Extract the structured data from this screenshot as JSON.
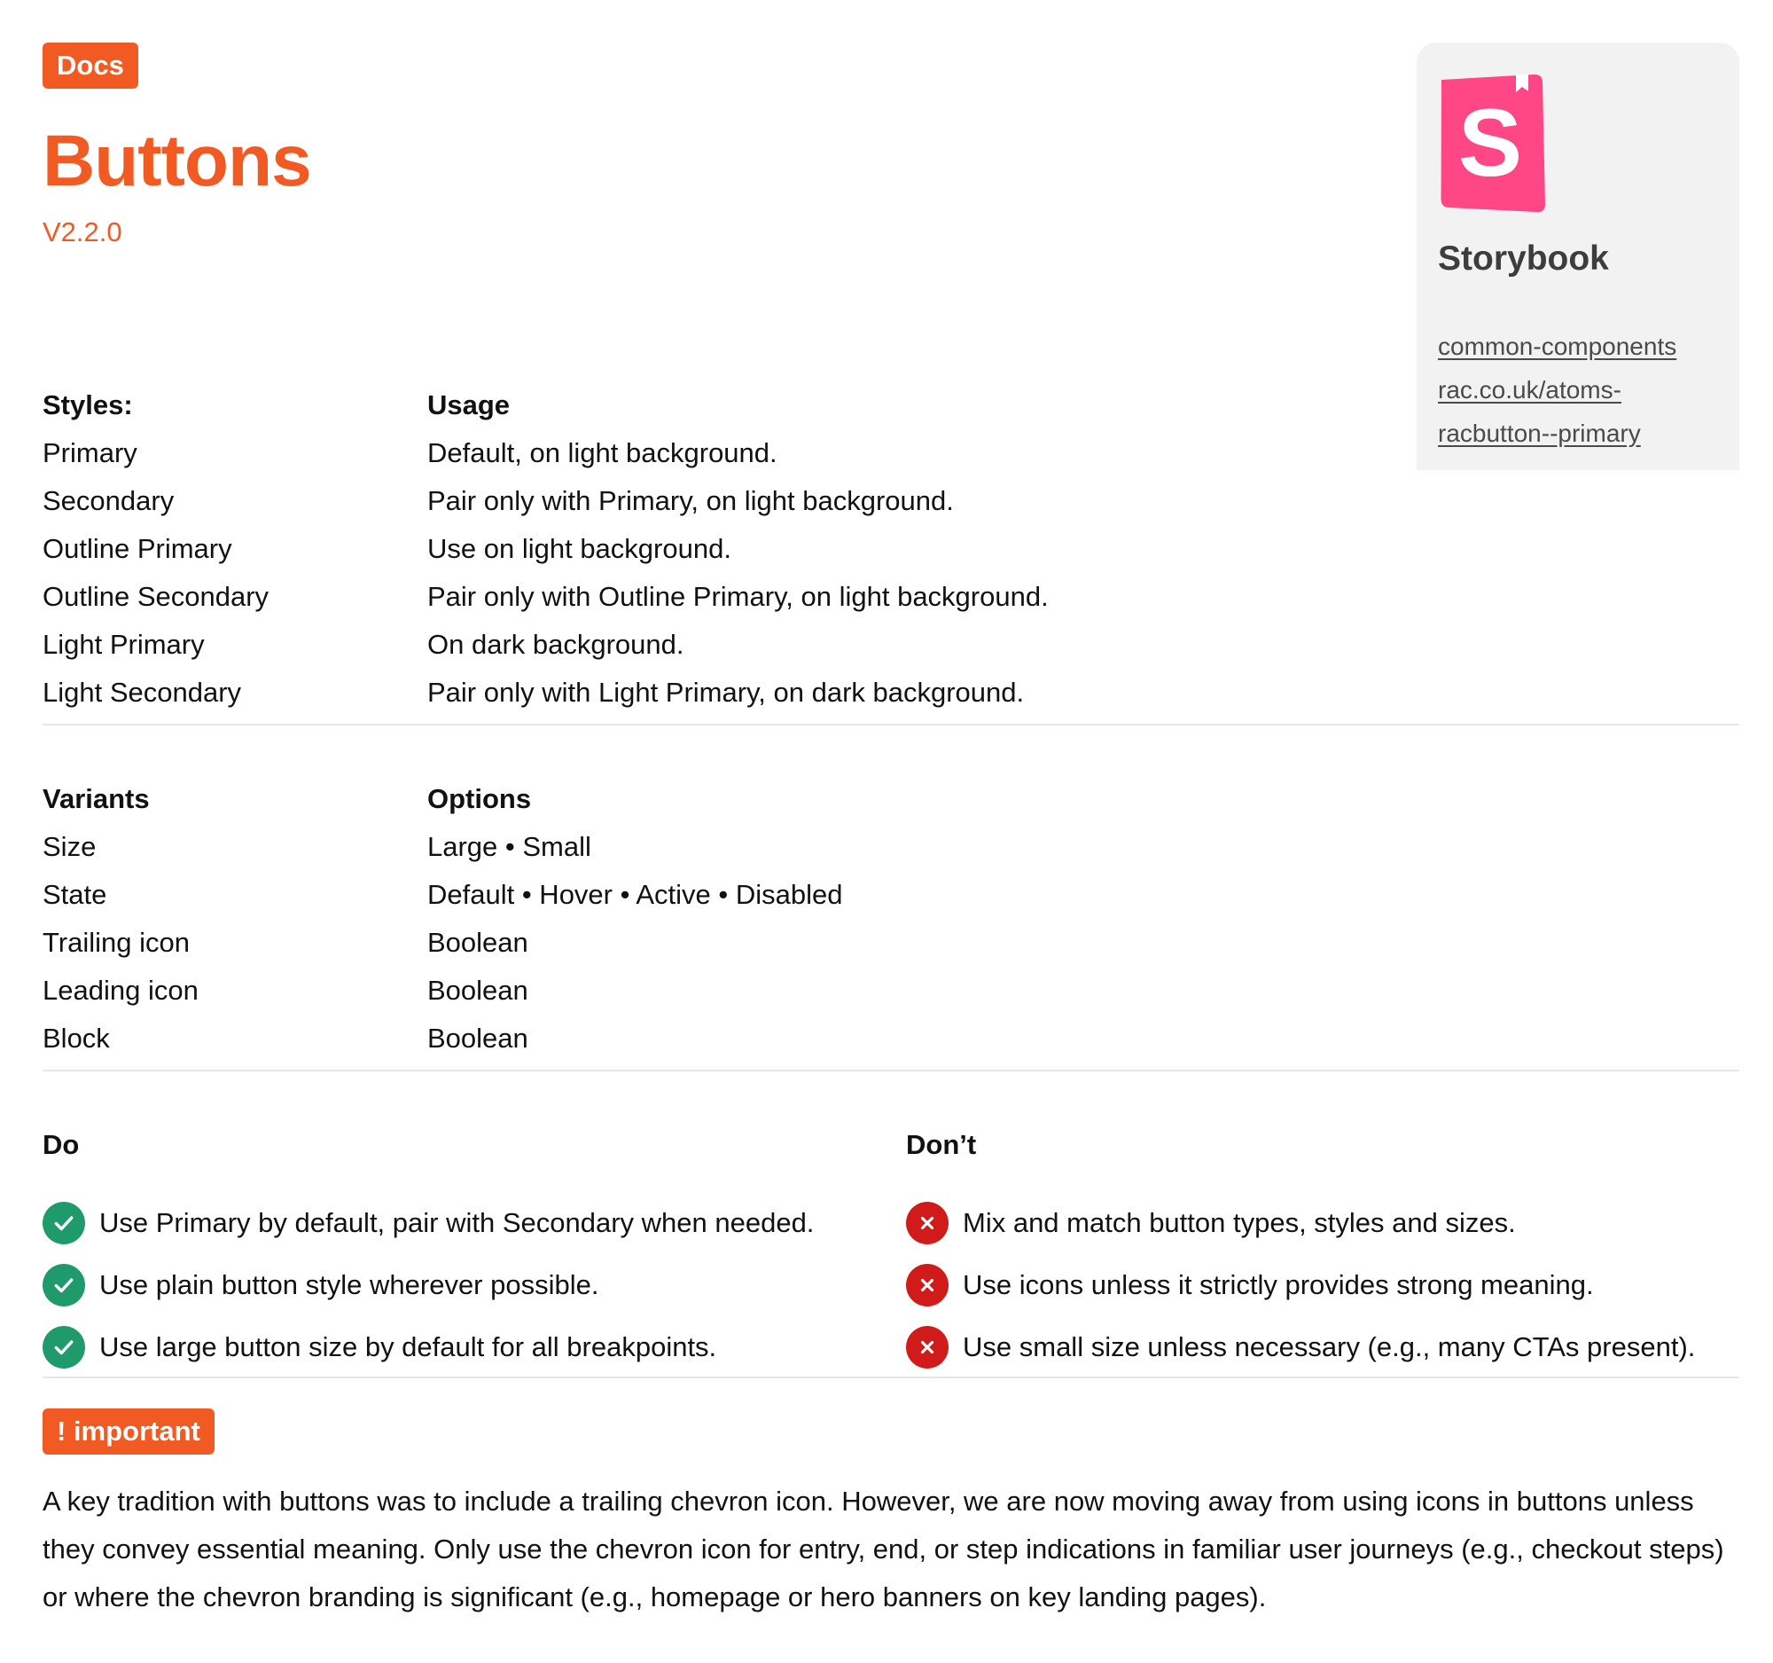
{
  "header": {
    "tag": "Docs",
    "title": "Buttons",
    "version": "V2.2.0"
  },
  "storybook": {
    "name": "Storybook",
    "logo_icon": "storybook-logo-icon",
    "link_lines": [
      "common-components",
      "rac.co.uk/atoms-",
      "racbutton--primary"
    ]
  },
  "styles_table": {
    "headers": [
      "Styles:",
      "Usage"
    ],
    "rows": [
      [
        "Primary",
        "Default, on light background."
      ],
      [
        "Secondary",
        "Pair only with Primary, on light background."
      ],
      [
        "Outline Primary",
        "Use on light background."
      ],
      [
        "Outline Secondary",
        "Pair only with Outline Primary, on light background."
      ],
      [
        "Light Primary",
        "On dark background."
      ],
      [
        "Light Secondary",
        "Pair only with Light Primary, on dark background."
      ]
    ]
  },
  "variants_table": {
    "headers": [
      "Variants",
      "Options"
    ],
    "rows": [
      [
        "Size",
        "Large • Small"
      ],
      [
        "State",
        "Default • Hover • Active • Disabled"
      ],
      [
        "Trailing icon",
        "Boolean"
      ],
      [
        "Leading icon",
        "Boolean"
      ],
      [
        "Block",
        "Boolean"
      ]
    ]
  },
  "do": {
    "heading": "Do",
    "icon": "check-circle-icon",
    "items": [
      "Use Primary by default, pair with Secondary when needed.",
      "Use plain button style wherever possible.",
      "Use large button size by default for all breakpoints."
    ]
  },
  "dont": {
    "heading": "Don’t",
    "icon": "x-circle-icon",
    "items": [
      "Mix and match button types, styles and sizes.",
      "Use icons unless it strictly provides strong meaning.",
      "Use small size unless necessary (e.g., many CTAs present)."
    ]
  },
  "important": {
    "tag": "! important",
    "text": "A key tradition with buttons was to include a trailing chevron icon. However, we are now moving away from using icons in buttons unless they convey essential meaning. Only use the chevron icon for entry, end, or step indications in familiar user journeys (e.g., checkout steps) or where the chevron branding is significant (e.g., homepage or hero banners on key landing pages)."
  },
  "colors": {
    "accent": "#f15a22",
    "success": "#1f9a6b",
    "danger": "#d11a1a",
    "storybook_pink": "#ff4785",
    "card_bg": "#f2f2f2"
  }
}
